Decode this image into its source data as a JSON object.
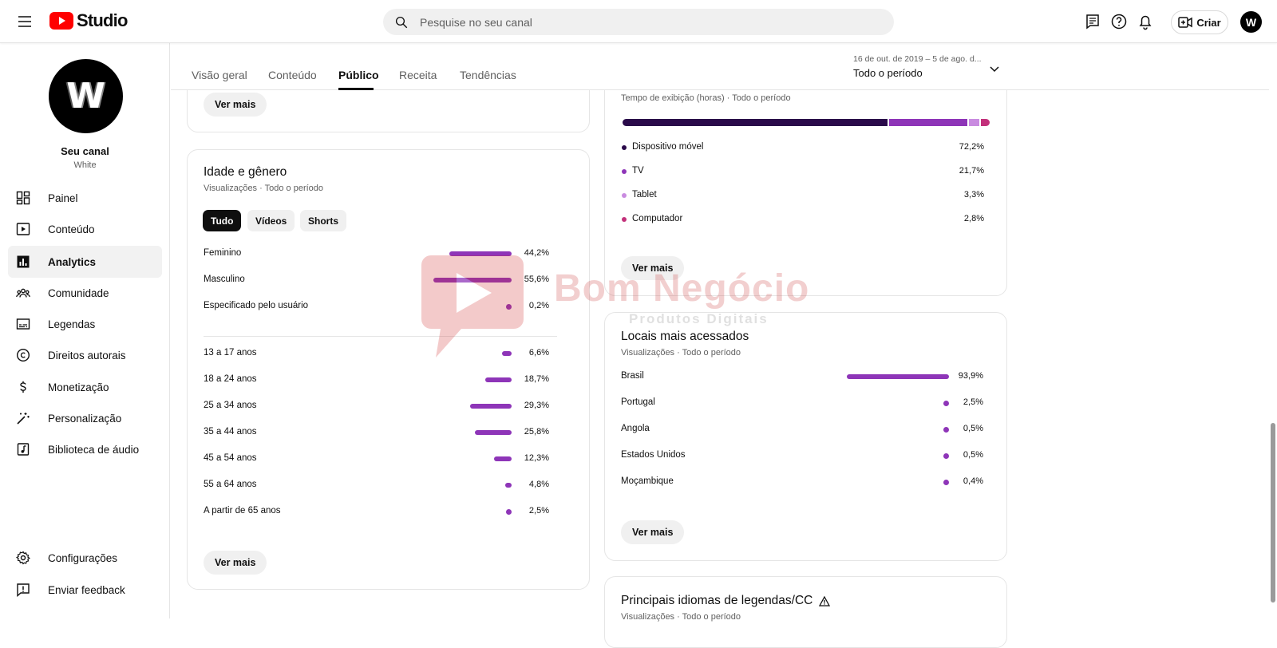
{
  "header": {
    "logo_text": "Studio",
    "search_placeholder": "Pesquise no seu canal",
    "create_label": "Criar",
    "avatar_letter": "W"
  },
  "sidebar": {
    "channel_name": "Seu canal",
    "channel_sub": "White",
    "avatar_letter": "W",
    "items": [
      {
        "label": "Painel",
        "icon": "dashboard-icon"
      },
      {
        "label": "Conteúdo",
        "icon": "content-icon"
      },
      {
        "label": "Analytics",
        "icon": "analytics-icon",
        "active": true
      },
      {
        "label": "Comunidade",
        "icon": "community-icon"
      },
      {
        "label": "Legendas",
        "icon": "subtitles-icon"
      },
      {
        "label": "Direitos autorais",
        "icon": "copyright-icon"
      },
      {
        "label": "Monetização",
        "icon": "monetization-icon"
      },
      {
        "label": "Personalização",
        "icon": "customization-icon"
      },
      {
        "label": "Biblioteca de áudio",
        "icon": "audio-library-icon"
      }
    ],
    "footer_items": [
      {
        "label": "Configurações",
        "icon": "settings-icon"
      },
      {
        "label": "Enviar feedback",
        "icon": "feedback-icon"
      }
    ]
  },
  "tabs": [
    "Visão geral",
    "Conteúdo",
    "Público",
    "Receita",
    "Tendências"
  ],
  "active_tab": "Público",
  "date": {
    "range": "16 de out. de 2019 – 5 de ago. d...",
    "period": "Todo o período"
  },
  "prev_card": {
    "button": "Ver mais"
  },
  "age_gender": {
    "title": "Idade e gênero",
    "subtitle": "Visualizações · Todo o período",
    "chips": [
      "Tudo",
      "Vídeos",
      "Shorts"
    ],
    "active_chip": "Tudo",
    "gender": [
      {
        "label": "Feminino",
        "value": "44,2%",
        "pct": 44.2
      },
      {
        "label": "Masculino",
        "value": "55,6%",
        "pct": 55.6
      },
      {
        "label": "Especificado pelo usuário",
        "value": "0,2%",
        "pct": 0.2
      }
    ],
    "age": [
      {
        "label": "13 a 17 anos",
        "value": "6,6%",
        "pct": 6.6
      },
      {
        "label": "18 a 24 anos",
        "value": "18,7%",
        "pct": 18.7
      },
      {
        "label": "25 a 34 anos",
        "value": "29,3%",
        "pct": 29.3
      },
      {
        "label": "35 a 44 anos",
        "value": "25,8%",
        "pct": 25.8
      },
      {
        "label": "45 a 54 anos",
        "value": "12,3%",
        "pct": 12.3
      },
      {
        "label": "55 a 64 anos",
        "value": "4,8%",
        "pct": 4.8
      },
      {
        "label": "A partir de 65 anos",
        "value": "2,5%",
        "pct": 2.5
      }
    ],
    "button": "Ver mais"
  },
  "devices": {
    "subtitle": "Tempo de exibição (horas) · Todo o período",
    "items": [
      {
        "label": "Dispositivo móvel",
        "value": "72,2%",
        "pct": 72.2,
        "color": "#2a0a4a"
      },
      {
        "label": "TV",
        "value": "21,7%",
        "pct": 21.7,
        "color": "#8e35b8"
      },
      {
        "label": "Tablet",
        "value": "3,3%",
        "pct": 3.3,
        "color": "#c98be0"
      },
      {
        "label": "Computador",
        "value": "2,8%",
        "pct": 2.8,
        "color": "#c2307a"
      }
    ],
    "button": "Ver mais"
  },
  "locations": {
    "title": "Locais mais acessados",
    "subtitle": "Visualizações · Todo o período",
    "items": [
      {
        "label": "Brasil",
        "value": "93,9%",
        "pct": 93.9
      },
      {
        "label": "Portugal",
        "value": "2,5%",
        "pct": 2.5
      },
      {
        "label": "Angola",
        "value": "0,5%",
        "pct": 0.5
      },
      {
        "label": "Estados Unidos",
        "value": "0,5%",
        "pct": 0.5
      },
      {
        "label": "Moçambique",
        "value": "0,4%",
        "pct": 0.4
      }
    ],
    "button": "Ver mais"
  },
  "languages": {
    "title": "Principais idiomas de legendas/CC",
    "subtitle": "Visualizações · Todo o período",
    "warning_icon": "warning-icon"
  },
  "watermark": {
    "text": "Bom Negócio",
    "sub": "Produtos Digitais"
  },
  "colors": {
    "accent": "#8e35b8",
    "brand_red": "#ff0000"
  }
}
